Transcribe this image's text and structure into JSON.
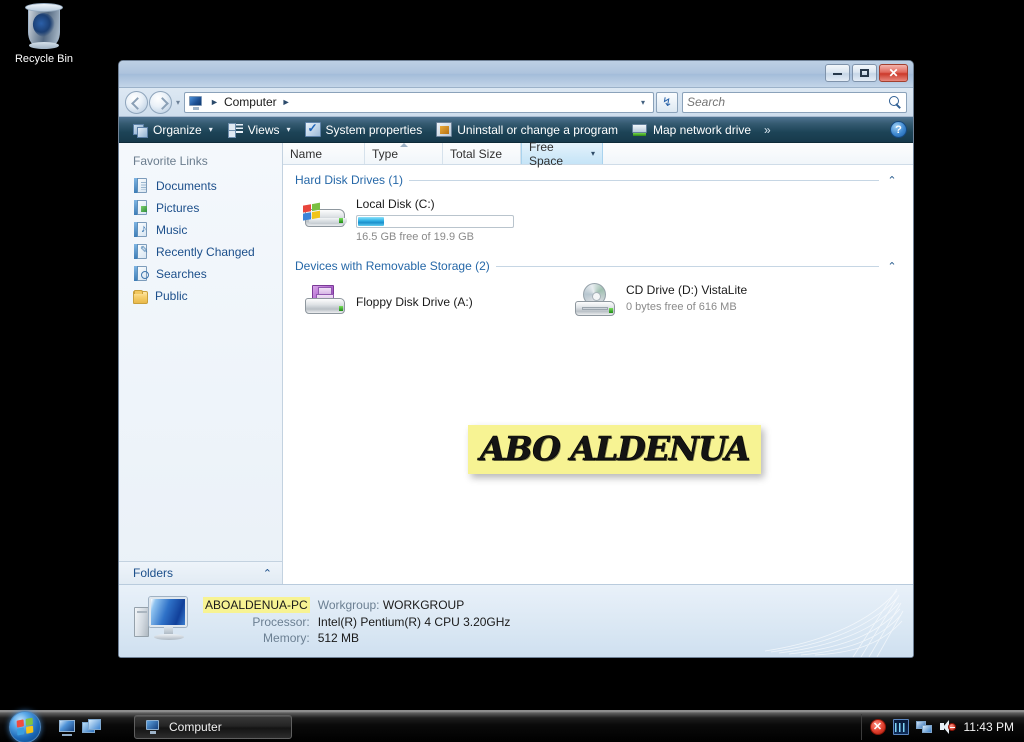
{
  "desktop": {
    "recycle_bin_label": "Recycle Bin",
    "recycle_bin_icon": "recycle-bin-icon"
  },
  "window": {
    "titlebar": {
      "minimize_label": "–",
      "maximize_label": "▫",
      "close_label": "✕"
    },
    "address": {
      "back_icon": "back-arrow-icon",
      "forward_icon": "forward-arrow-icon",
      "history_caret": "▾",
      "crumb_icon": "computer-icon",
      "crumb_sep_1": "►",
      "crumb_text": "Computer",
      "crumb_sep_2": "►",
      "dropdown_caret": "▾",
      "refresh_icon": "↯"
    },
    "search": {
      "placeholder": "Search",
      "icon": "search-icon"
    },
    "commandbar": {
      "organize_label": "Organize",
      "organize_caret": "▾",
      "views_label": "Views",
      "views_caret": "▾",
      "system_properties_label": "System properties",
      "uninstall_label": "Uninstall or change a program",
      "map_network_drive_label": "Map network drive",
      "overflow_label": "»",
      "help_label": "?"
    },
    "navpane": {
      "title": "Favorite Links",
      "items": [
        {
          "label": "Documents",
          "icon": "documents-icon"
        },
        {
          "label": "Pictures",
          "icon": "pictures-icon"
        },
        {
          "label": "Music",
          "icon": "music-icon"
        },
        {
          "label": "Recently Changed",
          "icon": "recently-changed-icon"
        },
        {
          "label": "Searches",
          "icon": "searches-icon"
        },
        {
          "label": "Public",
          "icon": "public-folder-icon"
        }
      ],
      "folders_label": "Folders",
      "folders_chevron": "⌃"
    },
    "columns": [
      {
        "label": "Name",
        "sorted": false,
        "hot": false
      },
      {
        "label": "Type",
        "sorted": true,
        "hot": false
      },
      {
        "label": "Total Size",
        "sorted": false,
        "hot": false
      },
      {
        "label": "Free Space",
        "sorted": false,
        "hot": true,
        "dropdown": "▾"
      }
    ],
    "groups": [
      {
        "title": "Hard Disk Drives (1)",
        "collapse": "⌃",
        "items": [
          {
            "name": "Local Disk (C:)",
            "icon": "hard-disk-drive-icon",
            "capacity_text": "16.5 GB free of 19.9 GB",
            "used_percent": 17
          }
        ]
      },
      {
        "title": "Devices with Removable Storage (2)",
        "collapse": "⌃",
        "items": [
          {
            "name": "Floppy Disk Drive (A:)",
            "icon": "floppy-disk-drive-icon",
            "capacity_text": ""
          },
          {
            "name": "CD Drive (D:) VistaLite",
            "icon": "cd-drive-icon",
            "capacity_text": "0 bytes free of 616 MB"
          }
        ]
      }
    ],
    "watermark": {
      "text": "ABO ALDENUA",
      "highlight_color": "#f7f393"
    },
    "details": {
      "pc_icon": "computer-workstation-icon",
      "pc_name": "ABOALDENUA-PC",
      "rows": [
        {
          "label": "Workgroup:",
          "value": "WORKGROUP"
        },
        {
          "label": "Processor:",
          "value": "Intel(R) Pentium(R) 4 CPU 3.20GHz"
        },
        {
          "label": "Memory:",
          "value": "512 MB"
        }
      ]
    }
  },
  "taskbar": {
    "start_icon": "windows-start-orb-icon",
    "quicklaunch": [
      {
        "icon": "show-desktop-icon"
      },
      {
        "icon": "switch-windows-icon"
      }
    ],
    "tasks": [
      {
        "label": "Computer",
        "icon": "computer-icon"
      }
    ],
    "tray": [
      {
        "icon": "security-alert-icon"
      },
      {
        "icon": "network-activity-graph-icon"
      },
      {
        "icon": "network-connection-icon"
      },
      {
        "icon": "volume-muted-icon"
      }
    ],
    "clock": "11:43 PM"
  },
  "colors": {
    "accent": "#1c4f8b",
    "commandbar": "#1d4457",
    "highlight": "#f7f393",
    "disk_bar": "#1a8fcc"
  }
}
